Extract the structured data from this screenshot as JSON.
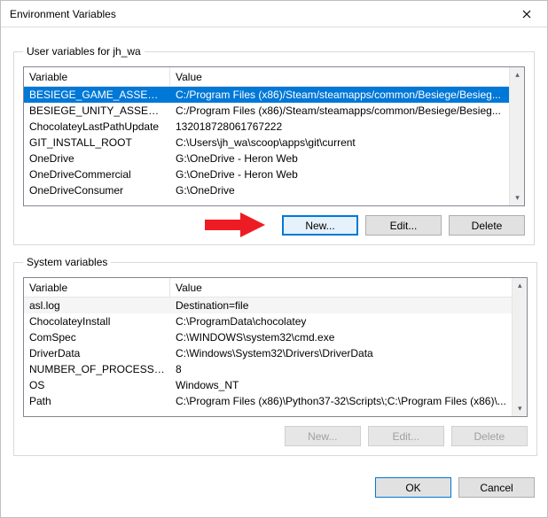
{
  "title": "Environment Variables",
  "userbox_legend": "User variables for jh_wa",
  "sysbox_legend": "System variables",
  "headers": {
    "variable": "Variable",
    "value": "Value"
  },
  "user_vars": [
    {
      "name": "BESIEGE_GAME_ASSEMBLIES",
      "value": "C:/Program Files (x86)/Steam/steamapps/common/Besiege/Besieg..."
    },
    {
      "name": "BESIEGE_UNITY_ASSEMBLIES",
      "value": "C:/Program Files (x86)/Steam/steamapps/common/Besiege/Besieg..."
    },
    {
      "name": "ChocolateyLastPathUpdate",
      "value": "132018728061767222"
    },
    {
      "name": "GIT_INSTALL_ROOT",
      "value": "C:\\Users\\jh_wa\\scoop\\apps\\git\\current"
    },
    {
      "name": "OneDrive",
      "value": "G:\\OneDrive - Heron Web"
    },
    {
      "name": "OneDriveCommercial",
      "value": "G:\\OneDrive - Heron Web"
    },
    {
      "name": "OneDriveConsumer",
      "value": "G:\\OneDrive"
    }
  ],
  "sys_vars": [
    {
      "name": "asl.log",
      "value": "Destination=file"
    },
    {
      "name": "ChocolateyInstall",
      "value": "C:\\ProgramData\\chocolatey"
    },
    {
      "name": "ComSpec",
      "value": "C:\\WINDOWS\\system32\\cmd.exe"
    },
    {
      "name": "DriverData",
      "value": "C:\\Windows\\System32\\Drivers\\DriverData"
    },
    {
      "name": "NUMBER_OF_PROCESSORS",
      "value": "8"
    },
    {
      "name": "OS",
      "value": "Windows_NT"
    },
    {
      "name": "Path",
      "value": "C:\\Program Files (x86)\\Python37-32\\Scripts\\;C:\\Program Files (x86)\\..."
    }
  ],
  "buttons": {
    "new": "New...",
    "edit": "Edit...",
    "delete": "Delete",
    "ok": "OK",
    "cancel": "Cancel"
  }
}
